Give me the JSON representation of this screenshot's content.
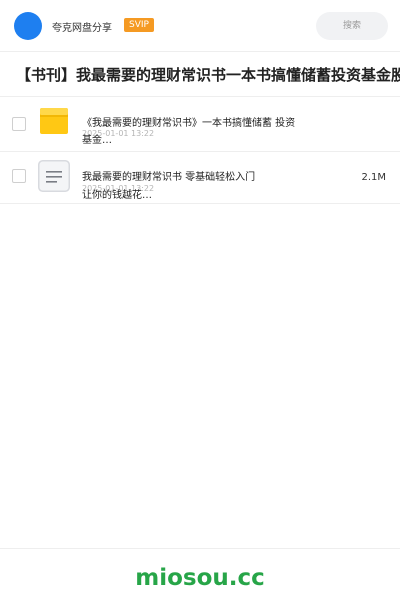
{
  "header": {
    "brand": "夸克网盘分享",
    "badge": "SVIP",
    "search_placeholder": "搜索",
    "avatar_color": "#1e7ff0",
    "badge_color": "#f59a23"
  },
  "title": "【书刊】我最需要的理财常识书一本书搞懂储蓄投资基金股",
  "files": [
    {
      "icon": "folder-icon",
      "name_line1": "《我最需要的理财常识书》一本书搞懂储蓄 投资",
      "name_line2": "基金…",
      "meta": "2025-01-01 13:22",
      "size": ""
    },
    {
      "icon": "document-icon",
      "name_line1": "我最需要的理财常识书 零基础轻松入门",
      "name_line2": "让你的钱越花…",
      "meta": "2025-01-01 13:22",
      "size": "2.1M"
    }
  ],
  "footer": {
    "site": "miosou.cc",
    "color": "#27a548"
  }
}
